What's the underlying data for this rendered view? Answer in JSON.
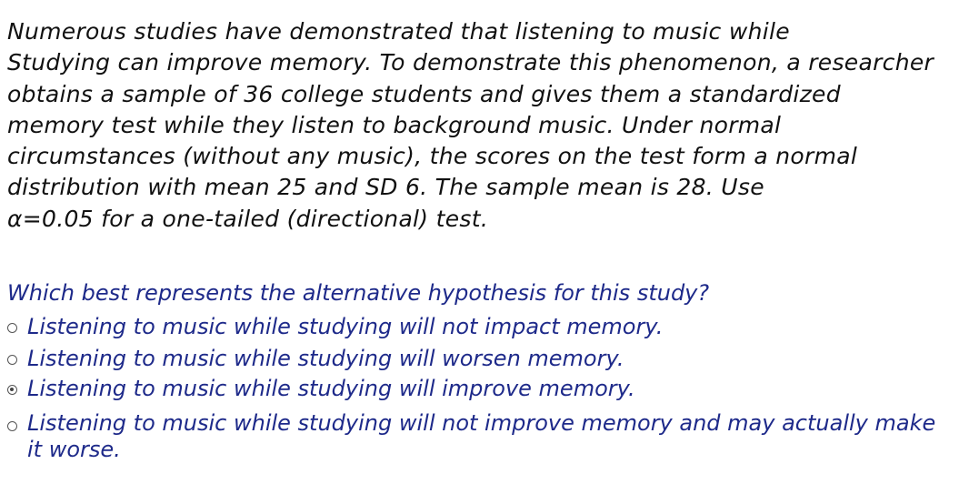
{
  "problem": {
    "lines": [
      "Numerous studies have demonstrated that listening to music while",
      "Studying can improve memory. To demonstrate this phenomenon, a researcher",
      "obtains a sample of 36 college students and gives them a standardized",
      "memory test while they listen to background music. Under normal",
      "circumstances (without any music), the scores on the test form a normal",
      "distribution with mean 25 and SD 6. The sample mean is 28. Use",
      "α=0.05 for a one-tailed (directional) test."
    ]
  },
  "question": {
    "text": "Which best represents the alternative hypothesis for this study?",
    "options": [
      {
        "label": "Listening to music while studying will not impact memory.",
        "selected": false
      },
      {
        "label": "Listening to music while studying will worsen memory.",
        "selected": false
      },
      {
        "label": "Listening to music while studying will improve memory.",
        "selected": true
      },
      {
        "label": "Listening to music while studying will not improve memory and may actually make it worse.",
        "selected": false
      }
    ]
  },
  "colors": {
    "problem_text": "#111111",
    "question_text": "#1e2a8a"
  }
}
